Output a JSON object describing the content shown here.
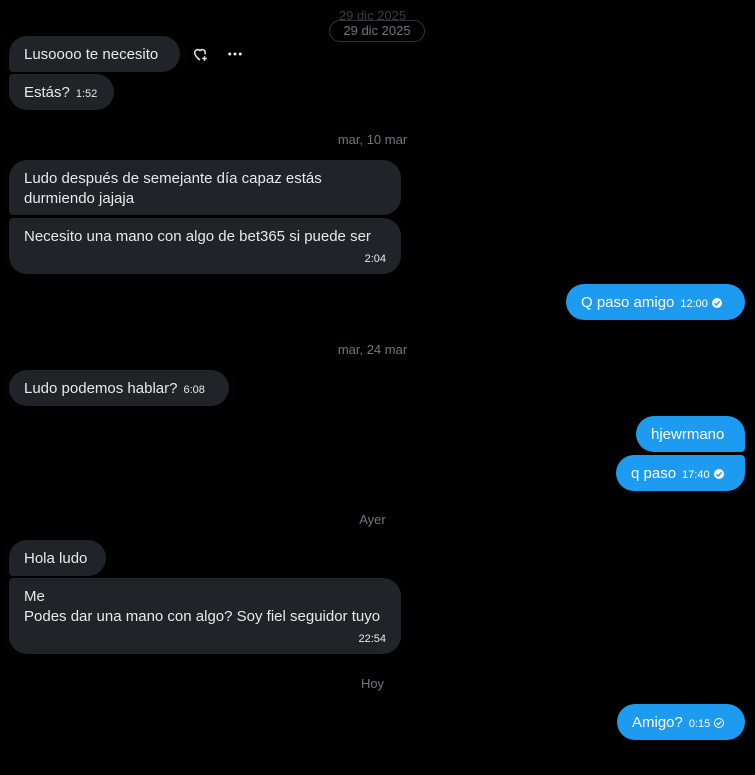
{
  "sticky_date": "29 dic 2025",
  "messages": [
    {
      "type": "in",
      "text": "Lusoooo te necesito"
    },
    {
      "type": "in",
      "text": "Estás?",
      "time": "1:52"
    },
    {
      "type": "divider",
      "text": "mar, 10 mar"
    },
    {
      "type": "in",
      "lines": [
        "Ludo después de semejante día capaz estás",
        "durmiendo jajaja"
      ]
    },
    {
      "type": "in",
      "text": "Necesito una mano con algo de bet365 si puede ser",
      "time": "2:04"
    },
    {
      "type": "out",
      "text": "Q paso amigo",
      "time": "12:00",
      "status": "read"
    },
    {
      "type": "divider",
      "text": "mar, 24 mar"
    },
    {
      "type": "in",
      "text": "Ludo podemos hablar?",
      "time": "6:08"
    },
    {
      "type": "out",
      "text": "hjewrmano"
    },
    {
      "type": "out",
      "text": "q paso",
      "time": "17:40",
      "status": "read"
    },
    {
      "type": "divider",
      "text": "Ayer"
    },
    {
      "type": "in",
      "text": "Hola ludo"
    },
    {
      "type": "in",
      "lines": [
        "Me",
        "Podes dar una mano con algo? Soy fiel seguidor tuyo"
      ],
      "time": "22:54"
    },
    {
      "type": "divider",
      "text": "Hoy"
    },
    {
      "type": "out",
      "text": "Amigo?",
      "time": "0:15",
      "status": "sent"
    }
  ],
  "actions": {
    "react_icon": "heart-plus-icon",
    "more_icon": "more-horizontal-icon"
  },
  "colors": {
    "background": "#000000",
    "incoming_bubble": "#202327",
    "outgoing_bubble": "#1d9bf0",
    "divider_text": "#71767b"
  }
}
